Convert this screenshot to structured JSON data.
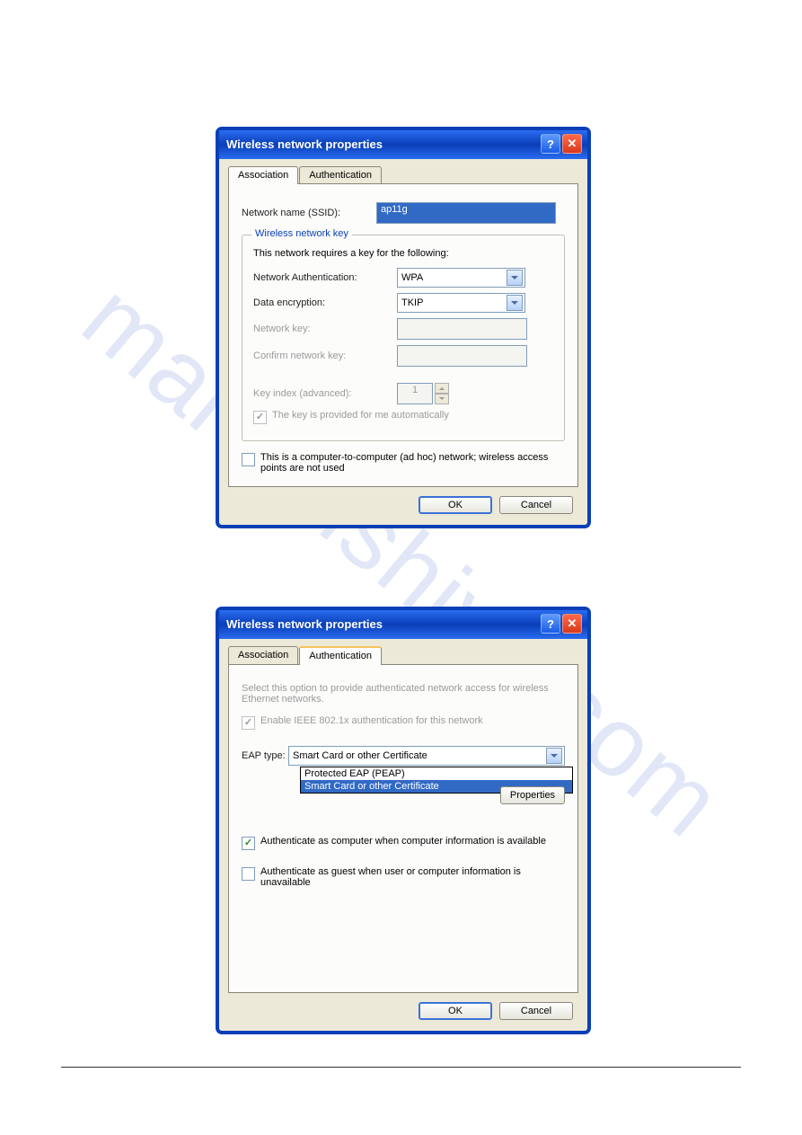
{
  "watermark": "manualshive.com",
  "dialog1": {
    "title": "Wireless network properties",
    "tabs": {
      "association": "Association",
      "authentication": "Authentication"
    },
    "networkNameLabel": "Network name (SSID):",
    "networkNameValue": "ap11g",
    "group": {
      "legend": "Wireless network key",
      "intro": "This network requires a key for the following:",
      "authLabel": "Network Authentication:",
      "authValue": "WPA",
      "encLabel": "Data encryption:",
      "encValue": "TKIP",
      "keyLabel": "Network key:",
      "confirmLabel": "Confirm network key:",
      "indexLabel": "Key index (advanced):",
      "indexValue": "1",
      "autoKey": "The key is provided for me automatically"
    },
    "adhoc": "This is a computer-to-computer (ad hoc) network; wireless access points are not used",
    "ok": "OK",
    "cancel": "Cancel"
  },
  "dialog2": {
    "title": "Wireless network properties",
    "tabs": {
      "association": "Association",
      "authentication": "Authentication"
    },
    "intro": "Select this option to provide authenticated network access for wireless Ethernet networks.",
    "enable8021x": "Enable IEEE 802.1x authentication for this network",
    "eapLabel": "EAP type:",
    "eapValue": "Smart Card or other Certificate",
    "eapOptions": [
      "Protected EAP (PEAP)",
      "Smart Card or other Certificate"
    ],
    "properties": "Properties",
    "authAsComputer": "Authenticate as computer when computer information is available",
    "authAsGuest": "Authenticate as guest when user or computer information is unavailable",
    "ok": "OK",
    "cancel": "Cancel"
  }
}
